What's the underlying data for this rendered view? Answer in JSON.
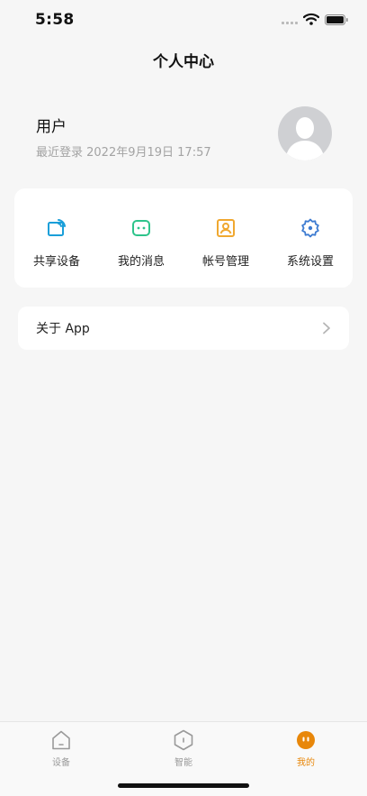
{
  "status_bar": {
    "time": "5:58"
  },
  "header": {
    "title": "个人中心"
  },
  "profile": {
    "name": "用户",
    "last_login": "最近登录 2022年9月19日 17:57",
    "avatar_icon": "default-user-avatar"
  },
  "actions": [
    {
      "label": "共享设备",
      "icon": "share-device-icon",
      "color": "#1a9fd9"
    },
    {
      "label": "我的消息",
      "icon": "message-icon",
      "color": "#2ec48b"
    },
    {
      "label": "帐号管理",
      "icon": "account-card-icon",
      "color": "#f0a830"
    },
    {
      "label": "系统设置",
      "icon": "settings-gear-icon",
      "color": "#3d7bd1"
    }
  ],
  "about": {
    "label": "关于 App",
    "icon": "chevron-right-icon"
  },
  "tab_bar": {
    "tabs": [
      {
        "label": "设备",
        "icon": "home-icon",
        "active": false
      },
      {
        "label": "智能",
        "icon": "hexagon-icon",
        "active": false
      },
      {
        "label": "我的",
        "icon": "me-face-icon",
        "active": true
      }
    ],
    "active_color": "#e8870a",
    "inactive_color": "#9a9a9a"
  }
}
